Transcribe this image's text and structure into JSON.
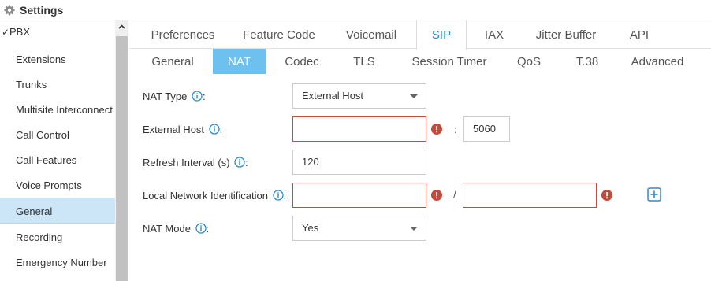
{
  "header": {
    "title": "Settings"
  },
  "sidebar": {
    "root": {
      "check": "✓",
      "label": "PBX"
    },
    "items": [
      {
        "label": "Extensions"
      },
      {
        "label": "Trunks"
      },
      {
        "label": "Multisite Interconnect"
      },
      {
        "label": "Call Control"
      },
      {
        "label": "Call Features"
      },
      {
        "label": "Voice Prompts"
      },
      {
        "label": "General"
      },
      {
        "label": "Recording"
      },
      {
        "label": "Emergency Number"
      }
    ],
    "selected": "General"
  },
  "tabs": {
    "primary": [
      {
        "label": "Preferences"
      },
      {
        "label": "Feature Code"
      },
      {
        "label": "Voicemail"
      },
      {
        "label": "SIP"
      },
      {
        "label": "IAX"
      },
      {
        "label": "Jitter Buffer"
      },
      {
        "label": "API"
      }
    ],
    "primary_active": "SIP",
    "secondary": [
      {
        "label": "General"
      },
      {
        "label": "NAT"
      },
      {
        "label": "Codec"
      },
      {
        "label": "TLS"
      },
      {
        "label": "Session Timer"
      },
      {
        "label": "QoS"
      },
      {
        "label": "T.38"
      },
      {
        "label": "Advanced"
      }
    ],
    "secondary_active": "NAT"
  },
  "form": {
    "nat_type": {
      "label": "NAT Type",
      "colon": ":",
      "value": "External Host"
    },
    "external_host": {
      "label": "External Host",
      "colon": ":",
      "value": "",
      "separator": ":",
      "port": "5060"
    },
    "refresh_interval": {
      "label": "Refresh Interval (s)",
      "colon": ":",
      "value": "120"
    },
    "local_network": {
      "label": "Local Network Identification",
      "colon": ":",
      "value_ip": "",
      "separator": "/",
      "value_mask": ""
    },
    "nat_mode": {
      "label": "NAT Mode",
      "colon": ":",
      "value": "Yes"
    }
  },
  "colors": {
    "accent": "#2a8ccf",
    "active_subtab": "#6ec1ee",
    "selected_row": "#cde6f7",
    "error": "#c24b3d"
  }
}
